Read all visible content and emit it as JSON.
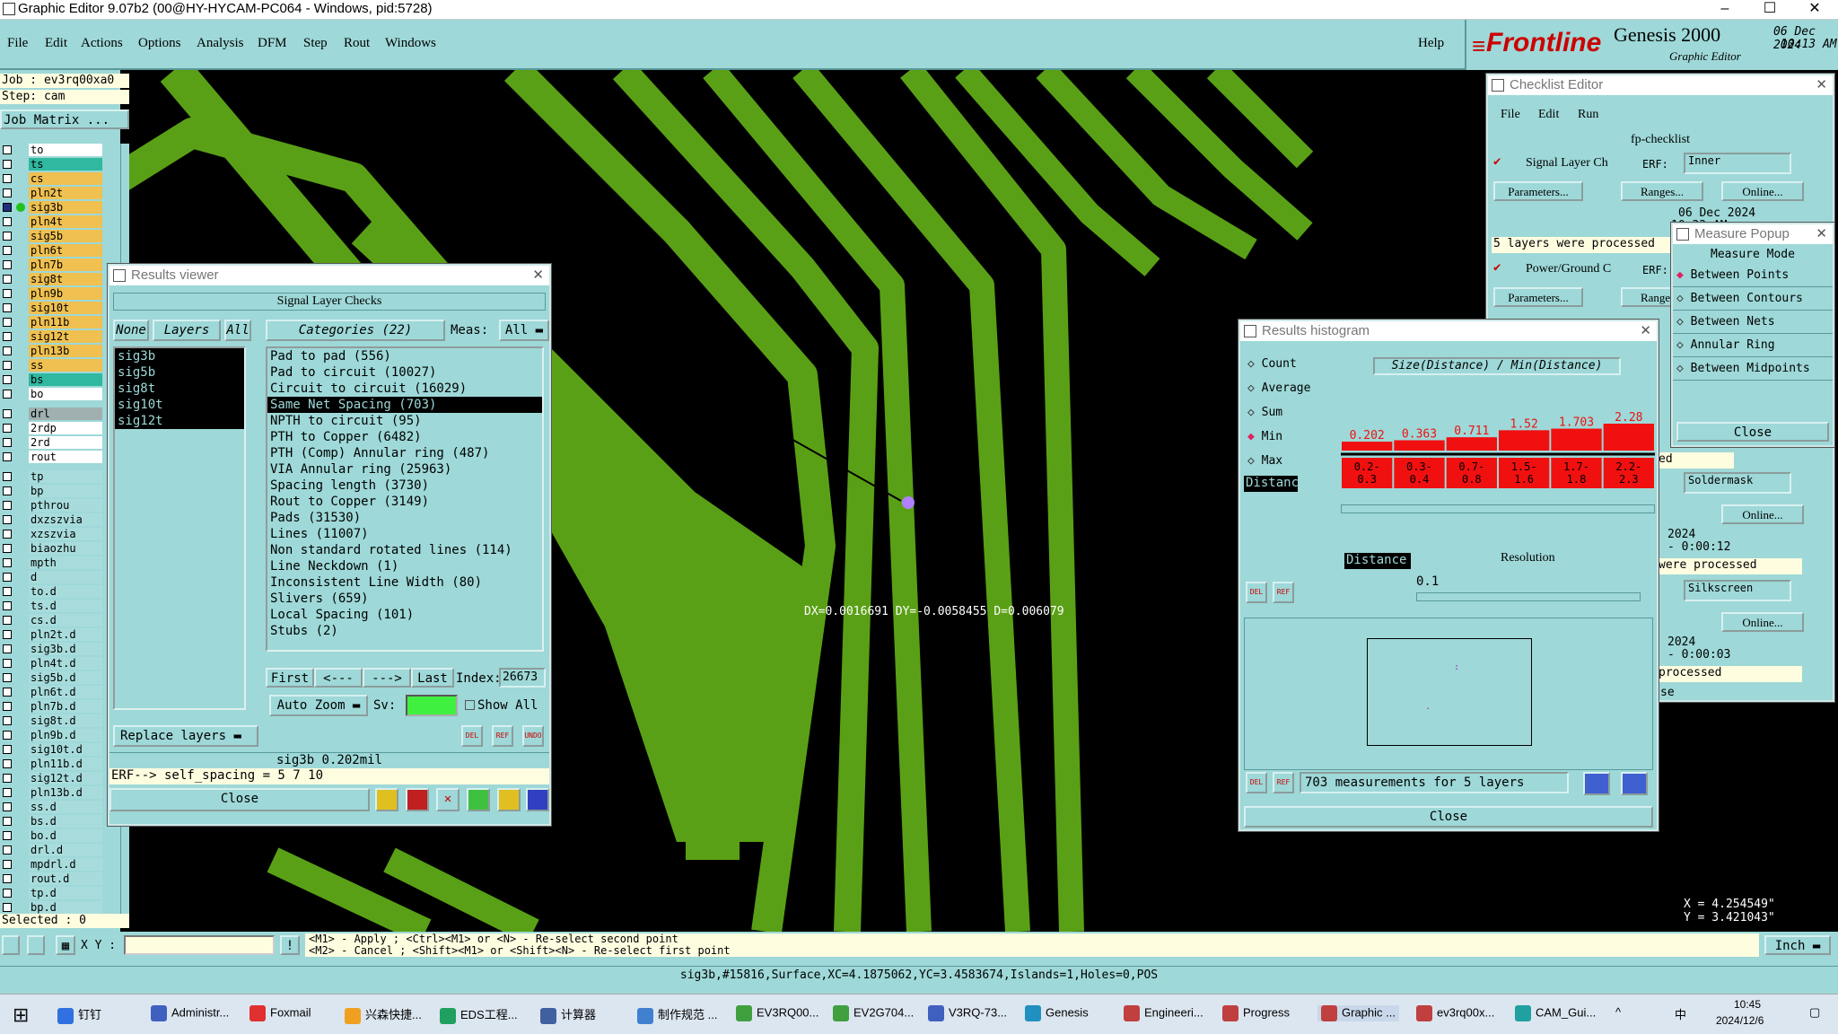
{
  "window": {
    "title": "Graphic Editor 9.07b2 (00@HY-HYCAM-PC064 - Windows, pid:5728)"
  },
  "menu": [
    "File",
    "Edit",
    "Actions",
    "Options",
    "Analysis",
    "DFM",
    "Step",
    "Rout",
    "Windows"
  ],
  "help": "Help",
  "logo": {
    "brand": "Frontline",
    "product": "Genesis 2000",
    "sub": "Graphic Editor",
    "date": "06 Dec 2024",
    "time": "10:13 AM"
  },
  "job": {
    "job": "Job : ev3rq00xa0",
    "step": "Step: cam",
    "matrix": "Job Matrix ..."
  },
  "layers": [
    {
      "n": "to",
      "c": "#ffffff"
    },
    {
      "n": "ts",
      "c": "#30b8a0"
    },
    {
      "n": "cs",
      "c": "#f0c050"
    },
    {
      "n": "pln2t",
      "c": "#f0c050"
    },
    {
      "n": "sig3b",
      "c": "#f0c050"
    },
    {
      "n": "pln4t",
      "c": "#f0c050"
    },
    {
      "n": "sig5b",
      "c": "#f0c050"
    },
    {
      "n": "pln6t",
      "c": "#f0c050"
    },
    {
      "n": "pln7b",
      "c": "#f0c050"
    },
    {
      "n": "sig8t",
      "c": "#f0c050"
    },
    {
      "n": "pln9b",
      "c": "#f0c050"
    },
    {
      "n": "sig10t",
      "c": "#f0c050"
    },
    {
      "n": "pln11b",
      "c": "#f0c050"
    },
    {
      "n": "sig12t",
      "c": "#f0c050"
    },
    {
      "n": "pln13b",
      "c": "#f0c050"
    },
    {
      "n": "ss",
      "c": "#f0c050"
    },
    {
      "n": "bs",
      "c": "#30b8a0"
    },
    {
      "n": "bo",
      "c": "#ffffff"
    },
    {
      "n": "drl",
      "c": "#a0b0b0"
    },
    {
      "n": "2rdp",
      "c": "#ffffff"
    },
    {
      "n": "2rd",
      "c": "#ffffff"
    },
    {
      "n": "rout",
      "c": "#ffffff"
    },
    {
      "n": "tp",
      "c": "#a8dcdc"
    },
    {
      "n": "bp",
      "c": "#a8dcdc"
    },
    {
      "n": "pthrou",
      "c": "#a8dcdc"
    },
    {
      "n": "dxzszvia",
      "c": "#a8dcdc"
    },
    {
      "n": "xzszvia",
      "c": "#a8dcdc"
    },
    {
      "n": "biaozhu",
      "c": "#a8dcdc"
    },
    {
      "n": "mpth",
      "c": "#a8dcdc"
    },
    {
      "n": "d",
      "c": "#a8dcdc"
    },
    {
      "n": "to.d",
      "c": "#a8dcdc"
    },
    {
      "n": "ts.d",
      "c": "#a8dcdc"
    },
    {
      "n": "cs.d",
      "c": "#a8dcdc"
    },
    {
      "n": "pln2t.d",
      "c": "#a8dcdc"
    },
    {
      "n": "sig3b.d",
      "c": "#a8dcdc"
    },
    {
      "n": "pln4t.d",
      "c": "#a8dcdc"
    },
    {
      "n": "sig5b.d",
      "c": "#a8dcdc"
    },
    {
      "n": "pln6t.d",
      "c": "#a8dcdc"
    },
    {
      "n": "pln7b.d",
      "c": "#a8dcdc"
    },
    {
      "n": "sig8t.d",
      "c": "#a8dcdc"
    },
    {
      "n": "pln9b.d",
      "c": "#a8dcdc"
    },
    {
      "n": "sig10t.d",
      "c": "#a8dcdc"
    },
    {
      "n": "pln11b.d",
      "c": "#a8dcdc"
    },
    {
      "n": "sig12t.d",
      "c": "#a8dcdc"
    },
    {
      "n": "pln13b.d",
      "c": "#a8dcdc"
    },
    {
      "n": "ss.d",
      "c": "#a8dcdc"
    },
    {
      "n": "bs.d",
      "c": "#a8dcdc"
    },
    {
      "n": "bo.d",
      "c": "#a8dcdc"
    },
    {
      "n": "drl.d",
      "c": "#a8dcdc"
    },
    {
      "n": "mpdrl.d",
      "c": "#a8dcdc"
    },
    {
      "n": "rout.d",
      "c": "#a8dcdc"
    },
    {
      "n": "tp.d",
      "c": "#a8dcdc"
    },
    {
      "n": "bp.d",
      "c": "#a8dcdc"
    }
  ],
  "selected": "Selected : 0",
  "results": {
    "title": "Results viewer",
    "header": "Signal Layer Checks",
    "none": "None",
    "layers_btn": "Layers",
    "all": "All",
    "categories_btn": "Categories (22)",
    "meas": "Meas:",
    "meas_val": "All",
    "layer_list": [
      "sig3b",
      "sig5b",
      "sig8t",
      "sig10t",
      "sig12t"
    ],
    "categories": [
      "Pad to pad (556)",
      "Pad to circuit (10027)",
      "Circuit to circuit (16029)",
      "Same Net Spacing (703)",
      "NPTH to circuit (95)",
      "PTH to Copper (6482)",
      "PTH (Comp) Annular ring (487)",
      "VIA Annular ring (25963)",
      "Spacing length (3730)",
      "Rout to Copper (3149)",
      "Pads (31530)",
      "Lines (11007)",
      "Non standard rotated lines (114)",
      "Line Neckdown (1)",
      "Inconsistent Line Width (80)",
      "Slivers (659)",
      "Local Spacing (101)",
      "Stubs (2)"
    ],
    "nav": [
      "First",
      "<---",
      "--->",
      "Last"
    ],
    "index_lbl": "Index:",
    "index": "26673",
    "autozoom": "Auto Zoom",
    "sv": "Sv:",
    "showall": "Show All",
    "replace": "Replace layers",
    "tool_icons": [
      "DEL",
      "REF",
      "UNDO"
    ],
    "info": "sig3b 0.202mil",
    "erf": "ERF--> self_spacing = 5 7 10",
    "close": "Close"
  },
  "measure_text": "DX=0.0016691 DY=-0.0058455 D=0.006079",
  "checklist": {
    "title": "Checklist Editor",
    "menu": [
      "File",
      "Edit",
      "Run"
    ],
    "name": "fp-checklist",
    "items": [
      {
        "name": "Signal Layer Ch",
        "erf_lbl": "ERF:",
        "erf": "Inner",
        "params": "Parameters...",
        "ranges": "Ranges...",
        "online": "Online...",
        "date": "06 Dec 2024",
        "time": "10:33 AM -",
        "status": "5 layers were processed"
      },
      {
        "name": "Power/Ground C",
        "erf_lbl": "ERF:",
        "params": "Parameters...",
        "ranges": "Ranges..."
      }
    ],
    "erf2": "Soldermask",
    "online2": "Online...",
    "date2": "2024",
    "time2": "- 0:00:12",
    "status2": "were processed",
    "erf3": "Silkscreen",
    "online3": "Online...",
    "date3": "2024",
    "time3": "- 0:00:03",
    "status3": "processed",
    "frag1": "ed",
    "frag2": "se"
  },
  "measure_popup": {
    "title": "Measure Popup",
    "mode": "Measure Mode",
    "options": [
      "Between Points",
      "Between Contours",
      "Between Nets",
      "Annular Ring",
      "Between Midpoints"
    ],
    "close": "Close"
  },
  "histogram": {
    "title": "Results histogram",
    "options": [
      "Count",
      "Average",
      "Sum",
      "Min",
      "Max"
    ],
    "selected": "Min",
    "header": "Size(Distance) / Min(Distance)",
    "bars": [
      0.202,
      0.363,
      0.711,
      1.52,
      1.703,
      2.28
    ],
    "bins": [
      [
        "0.2-",
        "0.3"
      ],
      [
        "0.3-",
        "0.4"
      ],
      [
        "0.7-",
        "0.8"
      ],
      [
        "1.5-",
        "1.6"
      ],
      [
        "1.7-",
        "1.8"
      ],
      [
        "2.2-",
        "2.3"
      ]
    ],
    "dist": "Distance",
    "dist2": "Distance",
    "resolution": "Resolution",
    "res_val": "0.1",
    "summary": "703 measurements for 5 layers",
    "close": "Close",
    "icons": [
      "DEL",
      "REF"
    ]
  },
  "coords": {
    "x": "X = 4.254549\"",
    "y": "Y = 3.421043\""
  },
  "status": {
    "xy": "X Y :",
    "hint1": "<M1> - Apply  ; <Ctrl><M1> or <N> - Re-select second point",
    "hint2": "<M2> - Cancel ; <Shift><M1> or <Shift><N> - Re-select first point",
    "unit": "Inch",
    "info": "sig3b,#15816,Surface,XC=4.1875062,YC=3.4583674,Islands=1,Holes=0,POS"
  },
  "taskbar": {
    "items": [
      "钉钉",
      "Administr...",
      "Foxmail",
      "兴森快捷...",
      "EDS工程...",
      "计算器",
      "制作规范 ...",
      "EV3RQ00...",
      "EV2G704...",
      "V3RQ-73...",
      "Genesis",
      "Engineeri...",
      "Progress",
      "Graphic ...",
      "ev3rq00x...",
      "CAM_Gui..."
    ],
    "time": "10:45",
    "date": "2024/12/6",
    "lang": "中"
  }
}
